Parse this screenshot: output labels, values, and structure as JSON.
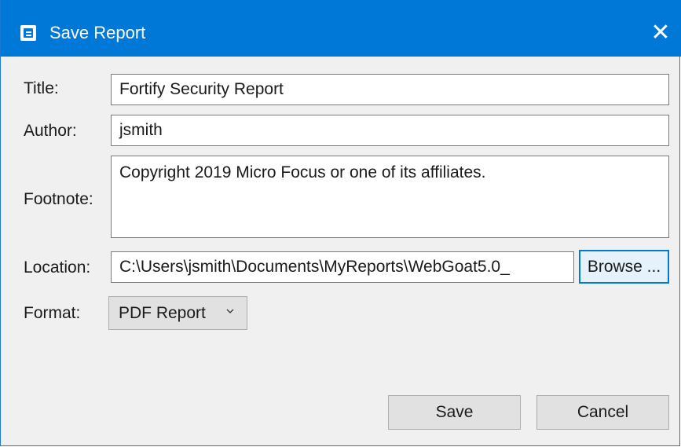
{
  "dialog": {
    "title": "Save Report",
    "close_glyph": "✕",
    "icon": "report-app-icon",
    "accent_color": "#0078d7"
  },
  "form": {
    "title_label": "Title:",
    "title_value": "Fortify Security Report",
    "author_label": "Author:",
    "author_value": "jsmith",
    "footnote_label": "Footnote:",
    "footnote_value": "Copyright 2019 Micro Focus or one of its affiliates.",
    "location_label": "Location:",
    "location_value": "C:\\Users\\jsmith\\Documents\\MyReports\\WebGoat5.0_",
    "browse_label": "Browse ...",
    "format_label": "Format:",
    "format_value": "PDF Report"
  },
  "actions": {
    "save_label": "Save",
    "cancel_label": "Cancel"
  }
}
